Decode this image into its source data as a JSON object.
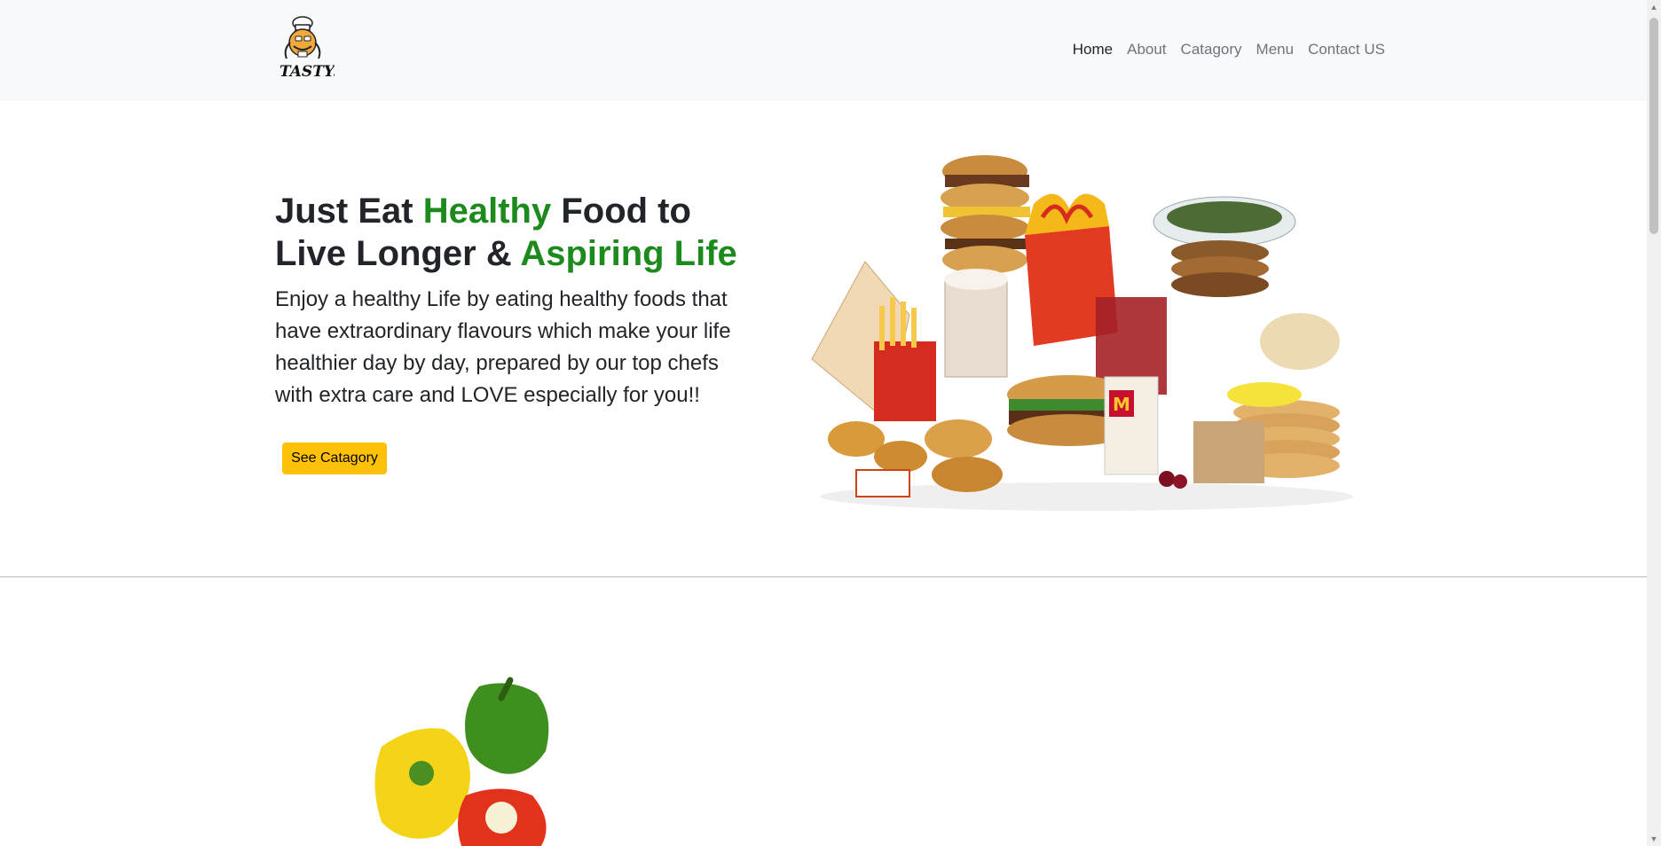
{
  "nav": {
    "logo_text": "TASTY.",
    "links": [
      "Home",
      "About",
      "Catagory",
      "Menu",
      "Contact US"
    ]
  },
  "hero": {
    "title_part1": "Just Eat ",
    "title_green1": "Healthy",
    "title_part2": " Food to",
    "title_part3": "Live Longer & ",
    "title_green2": "Aspiring Life",
    "description": "Enjoy a healthy Life by eating healthy foods that have extraordinary flavours which make your life healthier day by day, prepared by our top chefs with extra care and LOVE especially for you!!",
    "button_label": "See Catagory"
  },
  "colors": {
    "accent_green": "#1d8a1d",
    "button_yellow": "#ffc107",
    "navbar_bg": "#f8f9fa"
  },
  "icons": {
    "logo": "chef-logo-icon",
    "scroll_up": "scroll-up-arrow-icon",
    "scroll_down": "scroll-down-arrow-icon"
  }
}
